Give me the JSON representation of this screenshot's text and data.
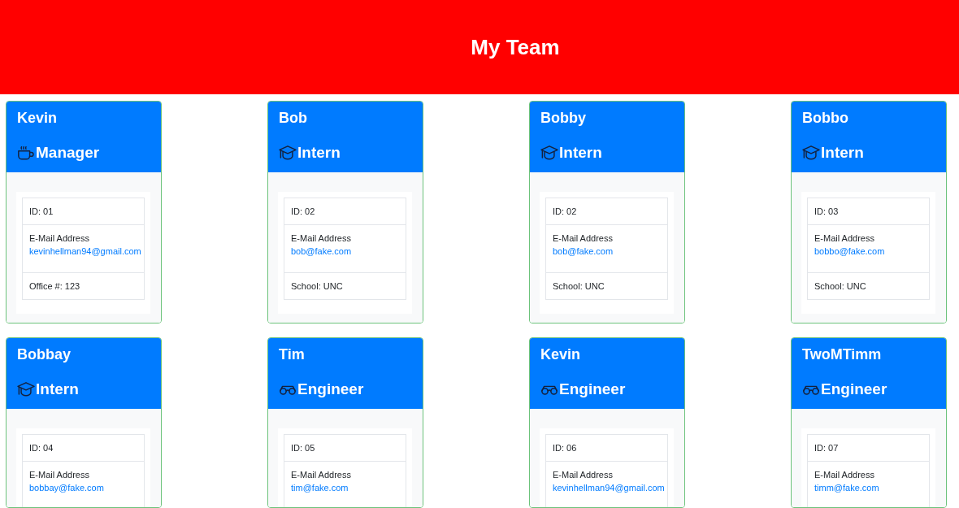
{
  "header": {
    "title": "My Team"
  },
  "employees": [
    {
      "name": "Kevin",
      "role": "Manager",
      "kind": "manager",
      "id": "ID: 01",
      "email_label": "E-Mail Address",
      "email": "kevinhellman94@gmail.com",
      "detail": "Office #: 123"
    },
    {
      "name": "Bob",
      "role": "Intern",
      "kind": "intern",
      "id": "ID: 02",
      "email_label": "E-Mail Address",
      "email": "bob@fake.com",
      "detail": "School: UNC"
    },
    {
      "name": "Bobby",
      "role": "Intern",
      "kind": "intern",
      "id": "ID: 02",
      "email_label": "E-Mail Address",
      "email": "bob@fake.com",
      "detail": "School: UNC"
    },
    {
      "name": "Bobbo",
      "role": "Intern",
      "kind": "intern",
      "id": "ID: 03",
      "email_label": "E-Mail Address",
      "email": "bobbo@fake.com",
      "detail": "School: UNC"
    },
    {
      "name": "Bobbay",
      "role": "Intern",
      "kind": "intern",
      "id": "ID: 04",
      "email_label": "E-Mail Address",
      "email": "bobbay@fake.com"
    },
    {
      "name": "Tim",
      "role": "Engineer",
      "kind": "engineer",
      "id": "ID: 05",
      "email_label": "E-Mail Address",
      "email": "tim@fake.com"
    },
    {
      "name": "Kevin",
      "role": "Engineer",
      "kind": "engineer",
      "id": "ID: 06",
      "email_label": "E-Mail Address",
      "email": "kevinhellman94@gmail.com"
    },
    {
      "name": "TwoMTimm",
      "role": "Engineer",
      "kind": "engineer",
      "id": "ID: 07",
      "email_label": "E-Mail Address",
      "email": "timm@fake.com"
    }
  ]
}
